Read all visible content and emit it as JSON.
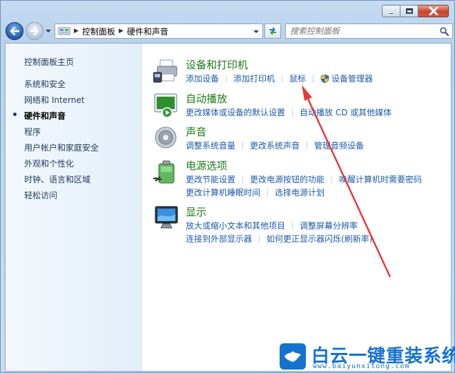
{
  "address": {
    "crumbs": [
      "控制面板",
      "硬件和声音"
    ]
  },
  "search": {
    "placeholder": "搜索控制面板"
  },
  "sidebar": {
    "items": [
      {
        "label": "控制面板主页",
        "active": false
      },
      {
        "label": "系统和安全",
        "active": false
      },
      {
        "label": "网络和 Internet",
        "active": false
      },
      {
        "label": "硬件和声音",
        "active": true
      },
      {
        "label": "程序",
        "active": false
      },
      {
        "label": "用户帐户和家庭安全",
        "active": false
      },
      {
        "label": "外观和个性化",
        "active": false
      },
      {
        "label": "时钟、语言和区域",
        "active": false
      },
      {
        "label": "轻松访问",
        "active": false
      }
    ]
  },
  "categories": [
    {
      "title": "设备和打印机",
      "icon": "printer-icon",
      "links": [
        [
          "添加设备",
          "添加打印机",
          "鼠标",
          "设备管理器"
        ]
      ]
    },
    {
      "title": "自动播放",
      "icon": "autoplay-icon",
      "links": [
        [
          "更改媒体或设备的默认设置",
          "自动播放 CD 或其他媒体"
        ]
      ]
    },
    {
      "title": "声音",
      "icon": "speaker-icon",
      "links": [
        [
          "调整系统音量",
          "更改系统声音",
          "管理音频设备"
        ]
      ]
    },
    {
      "title": "电源选项",
      "icon": "battery-icon",
      "links": [
        [
          "更改节能设置",
          "更改电源按钮的功能",
          "唤醒计算机时需要密码"
        ],
        [
          "更改计算机睡眠时间",
          "选择电源计划"
        ]
      ]
    },
    {
      "title": "显示",
      "icon": "monitor-icon",
      "links": [
        [
          "放大或缩小文本和其他项目",
          "调整屏幕分辨率"
        ],
        [
          "连接到外部显示器",
          "如何更正显示器闪烁(刷新率)"
        ]
      ]
    }
  ],
  "colors": {
    "category_title": "#1e7a15",
    "link": "#1e5aab",
    "annotation_arrow": "#e23b3b",
    "watermark": "#1672cf"
  },
  "watermark": {
    "title": "白云一键重装系统",
    "url": "www.baiyunxitong.com"
  }
}
